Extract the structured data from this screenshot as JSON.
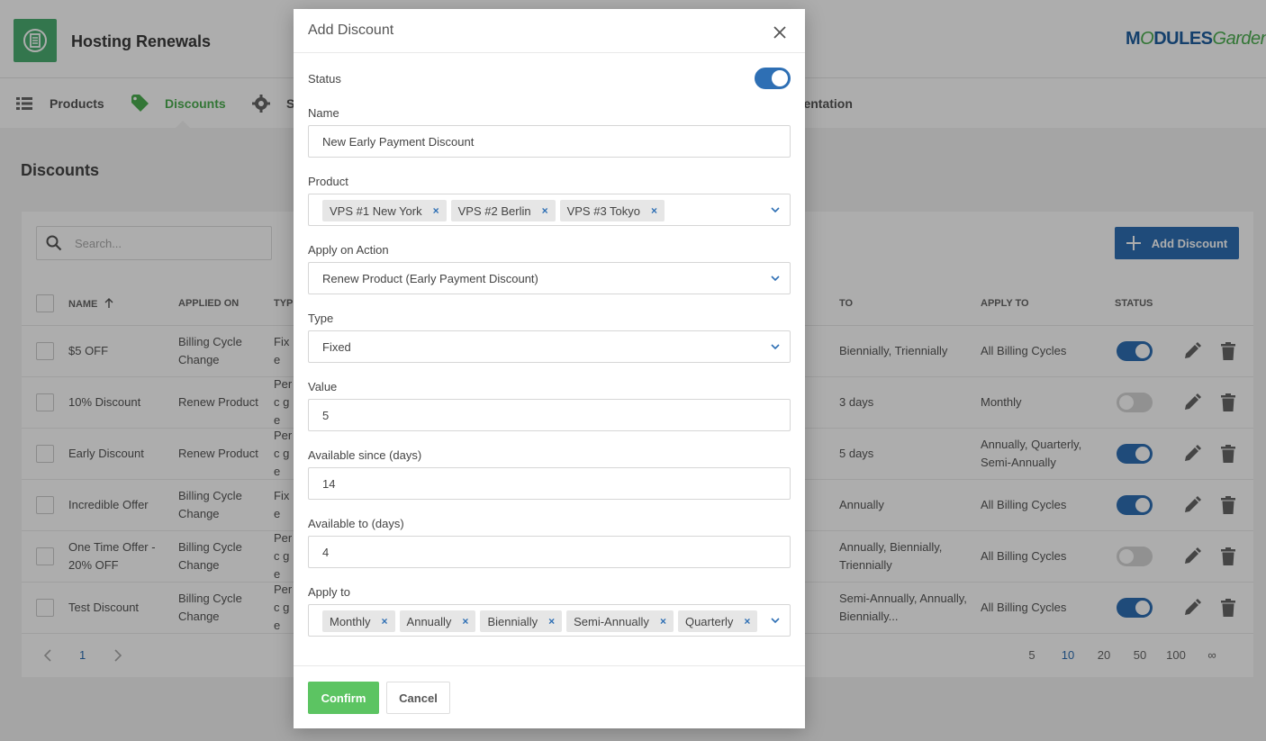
{
  "app": {
    "title": "Hosting Renewals",
    "brand_part1": "M",
    "brand_o": "O",
    "brand_part2": "DULES",
    "brand_part3": "Garden"
  },
  "nav": {
    "products": "Products",
    "discounts": "Discounts",
    "settings_partial": "S",
    "docs_partial": "mentation"
  },
  "page": {
    "title": "Discounts"
  },
  "toolbar": {
    "search_placeholder": "Search...",
    "add_label": "Add Discount"
  },
  "table": {
    "headers": {
      "name": "NAME",
      "applied_on": "APPLIED ON",
      "type": "TYPE",
      "to": "TO",
      "apply_to": "APPLY TO",
      "status": "STATUS"
    },
    "rows": [
      {
        "name": "$5 OFF",
        "applied_on": "Billing Cycle Change",
        "type": "Fixe",
        "to": "Biennially, Triennially",
        "apply_to": "All Billing Cycles",
        "status": true
      },
      {
        "name": "10% Discount",
        "applied_on": "Renew Product",
        "type": "Perc ge",
        "to": "3 days",
        "apply_to": "Monthly",
        "status": false
      },
      {
        "name": "Early Discount",
        "applied_on": "Renew Product",
        "type": "Perc ge",
        "to": "5 days",
        "apply_to": "Annually, Quarterly, Semi-Annually",
        "status": true
      },
      {
        "name": "Incredible Offer",
        "applied_on": "Billing Cycle Change",
        "type": "Fixe",
        "to": "Annually",
        "apply_to": "All Billing Cycles",
        "status": true
      },
      {
        "name": "One Time Offer - 20% OFF",
        "applied_on": "Billing Cycle Change",
        "type": "Perc ge",
        "to": "Annually, Biennially, Triennially",
        "apply_to": "All Billing Cycles",
        "status": false
      },
      {
        "name": "Test Discount",
        "applied_on": "Billing Cycle Change",
        "type": "Perc ge",
        "to": "Semi-Annually, Annually, Biennially...",
        "apply_to": "All Billing Cycles",
        "status": true
      }
    ]
  },
  "pagination": {
    "current_page": "1",
    "sizes": [
      "5",
      "10",
      "20",
      "50",
      "100",
      "∞"
    ],
    "active_size": "10"
  },
  "modal": {
    "title": "Add Discount",
    "status_label": "Status",
    "status_on": true,
    "name_label": "Name",
    "name_value": "New Early Payment Discount",
    "product_label": "Product",
    "products": [
      "VPS #1 New York",
      "VPS #2 Berlin",
      "VPS #3 Tokyo"
    ],
    "action_label": "Apply on Action",
    "action_value": "Renew Product (Early Payment Discount)",
    "type_label": "Type",
    "type_value": "Fixed",
    "value_label": "Value",
    "value_value": "5",
    "since_label": "Available since (days)",
    "since_value": "14",
    "to_label": "Available to (days)",
    "to_value": "4",
    "apply_to_label": "Apply to",
    "apply_to": [
      "Monthly",
      "Annually",
      "Biennially",
      "Semi-Annually",
      "Quarterly"
    ],
    "confirm_label": "Confirm",
    "cancel_label": "Cancel",
    "remove_glyph": "×"
  },
  "colors": {
    "primary": "#2e6fb4",
    "success": "#5cc462",
    "nav_active": "#4caf50"
  }
}
